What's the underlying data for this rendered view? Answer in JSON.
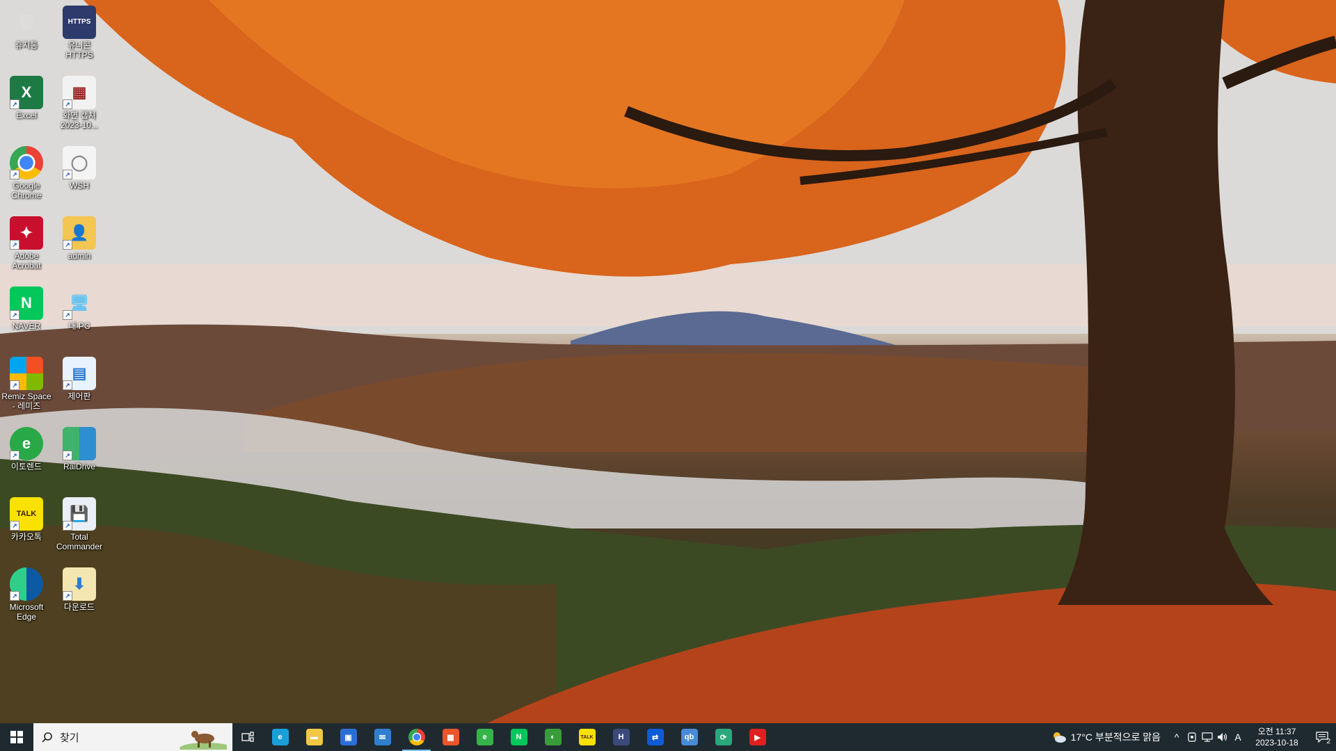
{
  "desktop": {
    "icons": [
      {
        "label": "휴지통",
        "icon": "recycle-bin-icon"
      },
      {
        "label": "유니콘\nHTTPS",
        "icon": "unicorn-https-icon"
      },
      {
        "label": "Excel",
        "icon": "excel-icon"
      },
      {
        "label": "화면 캡쳐\n2023-10...",
        "icon": "screenshot-file-icon"
      },
      {
        "label": "Google\nChrome",
        "icon": "chrome-icon"
      },
      {
        "label": "WSH",
        "icon": "wsh-file-icon"
      },
      {
        "label": "Adobe\nAcrobat",
        "icon": "acrobat-icon"
      },
      {
        "label": "admin",
        "icon": "user-folder-icon"
      },
      {
        "label": "NAVER",
        "icon": "naver-icon"
      },
      {
        "label": "내 PC",
        "icon": "this-pc-icon"
      },
      {
        "label": "Remiz Space\n- 레미즈",
        "icon": "remiz-space-icon"
      },
      {
        "label": "제어판",
        "icon": "control-panel-icon"
      },
      {
        "label": "이토렌드",
        "icon": "etoland-icon"
      },
      {
        "label": "RaiDrive",
        "icon": "raidrive-icon"
      },
      {
        "label": "카카오톡",
        "icon": "kakaotalk-icon"
      },
      {
        "label": "Total\nCommander",
        "icon": "total-commander-icon"
      },
      {
        "label": "Microsoft\nEdge",
        "icon": "edge-icon"
      },
      {
        "label": "다운로드",
        "icon": "downloads-folder-icon"
      }
    ]
  },
  "taskbar": {
    "search_placeholder": "찾기",
    "apps": [
      {
        "name": "edge",
        "icon": "edge-icon",
        "color": "#1a9fd9"
      },
      {
        "name": "file-explorer",
        "icon": "folder-icon",
        "color": "#f2c744"
      },
      {
        "name": "store",
        "icon": "store-icon",
        "color": "#2b6fd6"
      },
      {
        "name": "mail",
        "icon": "mail-icon",
        "color": "#2f7fd1"
      },
      {
        "name": "chrome",
        "icon": "chrome-icon",
        "color": "#e34133",
        "active": true
      },
      {
        "name": "remiz",
        "icon": "remiz-icon",
        "color": "#e8562a"
      },
      {
        "name": "etoland",
        "icon": "etoland-icon",
        "color": "#35b44a"
      },
      {
        "name": "naver",
        "icon": "naver-icon",
        "color": "#03c75a"
      },
      {
        "name": "web",
        "icon": "globe-icon",
        "color": "#3a9b3a"
      },
      {
        "name": "kakaotalk",
        "icon": "kakaotalk-icon",
        "color": "#fae100"
      },
      {
        "name": "https",
        "icon": "unicorn-https-icon",
        "color": "#3b4a7a"
      },
      {
        "name": "teamviewer",
        "icon": "teamviewer-icon",
        "color": "#0e5bd8"
      },
      {
        "name": "qbittorrent",
        "icon": "qbittorrent-icon",
        "color": "#4a8bd8"
      },
      {
        "name": "sync",
        "icon": "sync-icon",
        "color": "#2aa87c"
      },
      {
        "name": "youtube",
        "icon": "youtube-icon",
        "color": "#e02020"
      }
    ],
    "weather": "17°C 부분적으로 맑음",
    "ime": "A",
    "clock": {
      "period_time": "오전 11:37",
      "date": "2023-10-18"
    },
    "notification_count": "2"
  }
}
